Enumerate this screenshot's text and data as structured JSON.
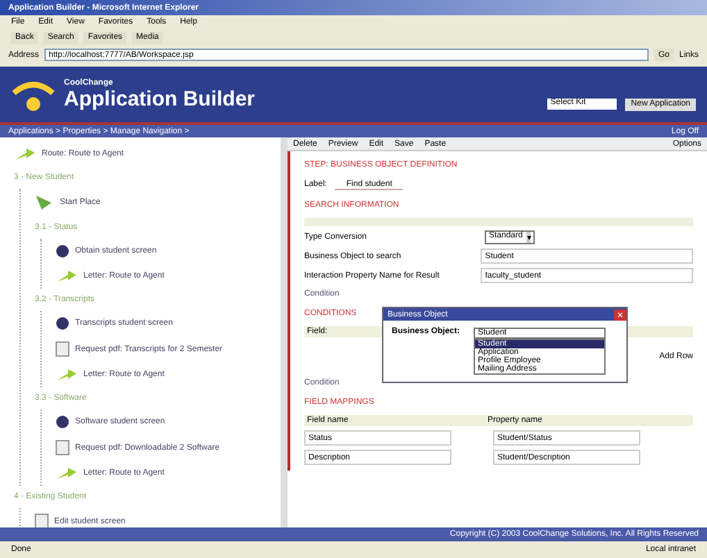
{
  "window": {
    "title": "Application Builder - Microsoft Internet Explorer"
  },
  "menu": [
    "File",
    "Edit",
    "View",
    "Favorites",
    "Tools",
    "Help"
  ],
  "toolbar": [
    "Back",
    "Search",
    "Favorites",
    "Media"
  ],
  "address": {
    "label": "Address",
    "value": "http://localhost:7777/AB/Workspace.jsp",
    "go": "Go",
    "links": "Links"
  },
  "header": {
    "brand": "CoolChange",
    "title": "Application Builder",
    "select": "Select Kit",
    "button": "New Application"
  },
  "breadcrumb": {
    "text": "Applications > Properties > Manage Navigation >",
    "logout": "Log Off"
  },
  "tree": [
    {
      "kind": "route",
      "label": "Route: Route to Agent"
    },
    {
      "kind": "group",
      "label": "3 - New Student",
      "children": [
        {
          "kind": "start",
          "label": "Start Place"
        },
        {
          "kind": "group",
          "label": "3.1 - Status",
          "children": [
            {
              "kind": "screen",
              "label": "Obtain student screen"
            },
            {
              "kind": "route",
              "label": "Letter: Route to Agent"
            }
          ]
        },
        {
          "kind": "group",
          "label": "3.2 - Transcripts",
          "children": [
            {
              "kind": "screen",
              "label": "Transcripts student screen"
            },
            {
              "kind": "doc",
              "label": "Request pdf: Transcripts for 2 Semester"
            },
            {
              "kind": "route",
              "label": "Letter: Route to Agent"
            }
          ]
        },
        {
          "kind": "group",
          "label": "3.3 - Software",
          "children": [
            {
              "kind": "screen",
              "label": "Software student screen"
            },
            {
              "kind": "doc",
              "label": "Request pdf: Downloadable 2 Software"
            },
            {
              "kind": "route",
              "label": "Letter: Route to Agent"
            }
          ]
        }
      ]
    },
    {
      "kind": "group",
      "label": "4 - Existing Student",
      "children": [
        {
          "kind": "doc",
          "label": "Edit student screen"
        }
      ]
    }
  ],
  "actions": [
    "Delete",
    "Preview",
    "Edit",
    "Save",
    "Paste"
  ],
  "options": "Options",
  "step_title": "STEP: BUSINESS OBJECT DEFINITION",
  "label_field": {
    "label": "Label:",
    "value": "Find student"
  },
  "search_title": "SEARCH INFORMATION",
  "fields": [
    {
      "kind": "select",
      "label": "Type Conversion",
      "value": "Standard",
      "arrow": "▾"
    },
    {
      "kind": "text",
      "label": "Business Object to search",
      "value": "Student"
    },
    {
      "kind": "text",
      "label": "Interaction Property Name for Result",
      "value": "faculty_student"
    }
  ],
  "condition_link": "Condition",
  "condition_title": "CONDITIONS",
  "cond_header": "Field:",
  "add_link": "Add Row",
  "cond_footer": "Condition",
  "mapping_title": "FIELD MAPPINGS",
  "mapping_columns": [
    "Field name",
    "Property name"
  ],
  "mapping_rows": [
    [
      "Status",
      "Student/Status"
    ],
    [
      "Description",
      "Student/Description"
    ]
  ],
  "dialog": {
    "title": "Business Object",
    "close": "✕",
    "label": "Business Object:",
    "value": "Student",
    "options": [
      {
        "label": "Student",
        "selected": true
      },
      {
        "label": "Application",
        "selected": false
      },
      {
        "label": "Profile Employee",
        "selected": false
      },
      {
        "label": "Mailing Address",
        "selected": false
      }
    ]
  },
  "footer": "Copyright (C) 2003 CoolChange Solutions, Inc. All Rights Reserved",
  "status": {
    "left": "Done",
    "right": "Local intranet"
  }
}
